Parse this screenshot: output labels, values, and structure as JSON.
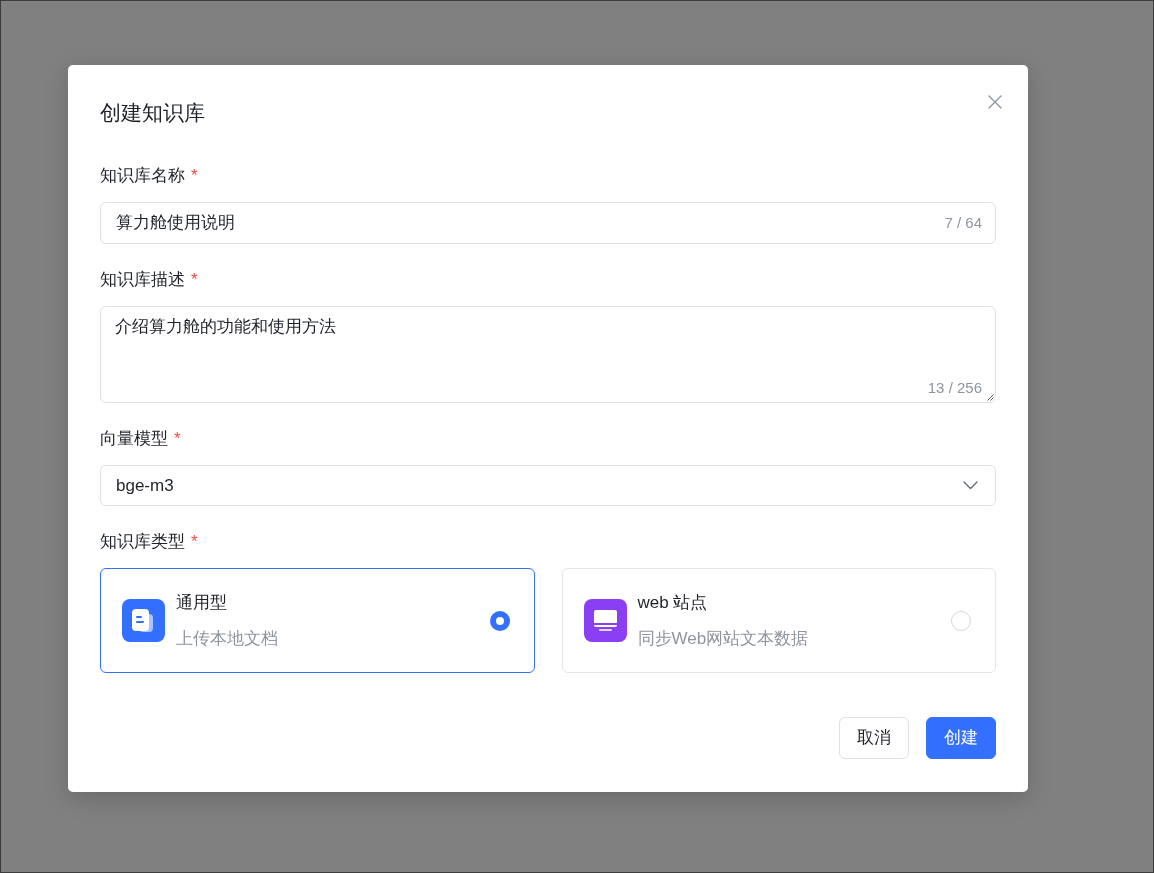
{
  "dialog": {
    "title": "创建知识库"
  },
  "fields": [
    {
      "kind": "input",
      "label": "知识库名称",
      "required_mark": "*",
      "value": "算力舱使用说明",
      "counter": "7 / 64"
    },
    {
      "kind": "textarea",
      "label": "知识库描述",
      "required_mark": "*",
      "value": "介绍算力舱的功能和使用方法",
      "counter": "13 / 256"
    },
    {
      "kind": "select",
      "label": "向量模型",
      "required_mark": "*",
      "value": "bge-m3"
    },
    {
      "kind": "cards",
      "label": "知识库类型",
      "required_mark": "*",
      "options": [
        {
          "kind": "document",
          "title": "通用型",
          "description": "上传本地文档",
          "selected": true
        },
        {
          "kind": "website",
          "title": "web 站点",
          "description": "同步Web网站文本数据",
          "selected": false
        }
      ]
    }
  ],
  "buttons": [
    {
      "kind": "secondary",
      "label": "取消"
    },
    {
      "kind": "primary",
      "label": "创建"
    }
  ]
}
